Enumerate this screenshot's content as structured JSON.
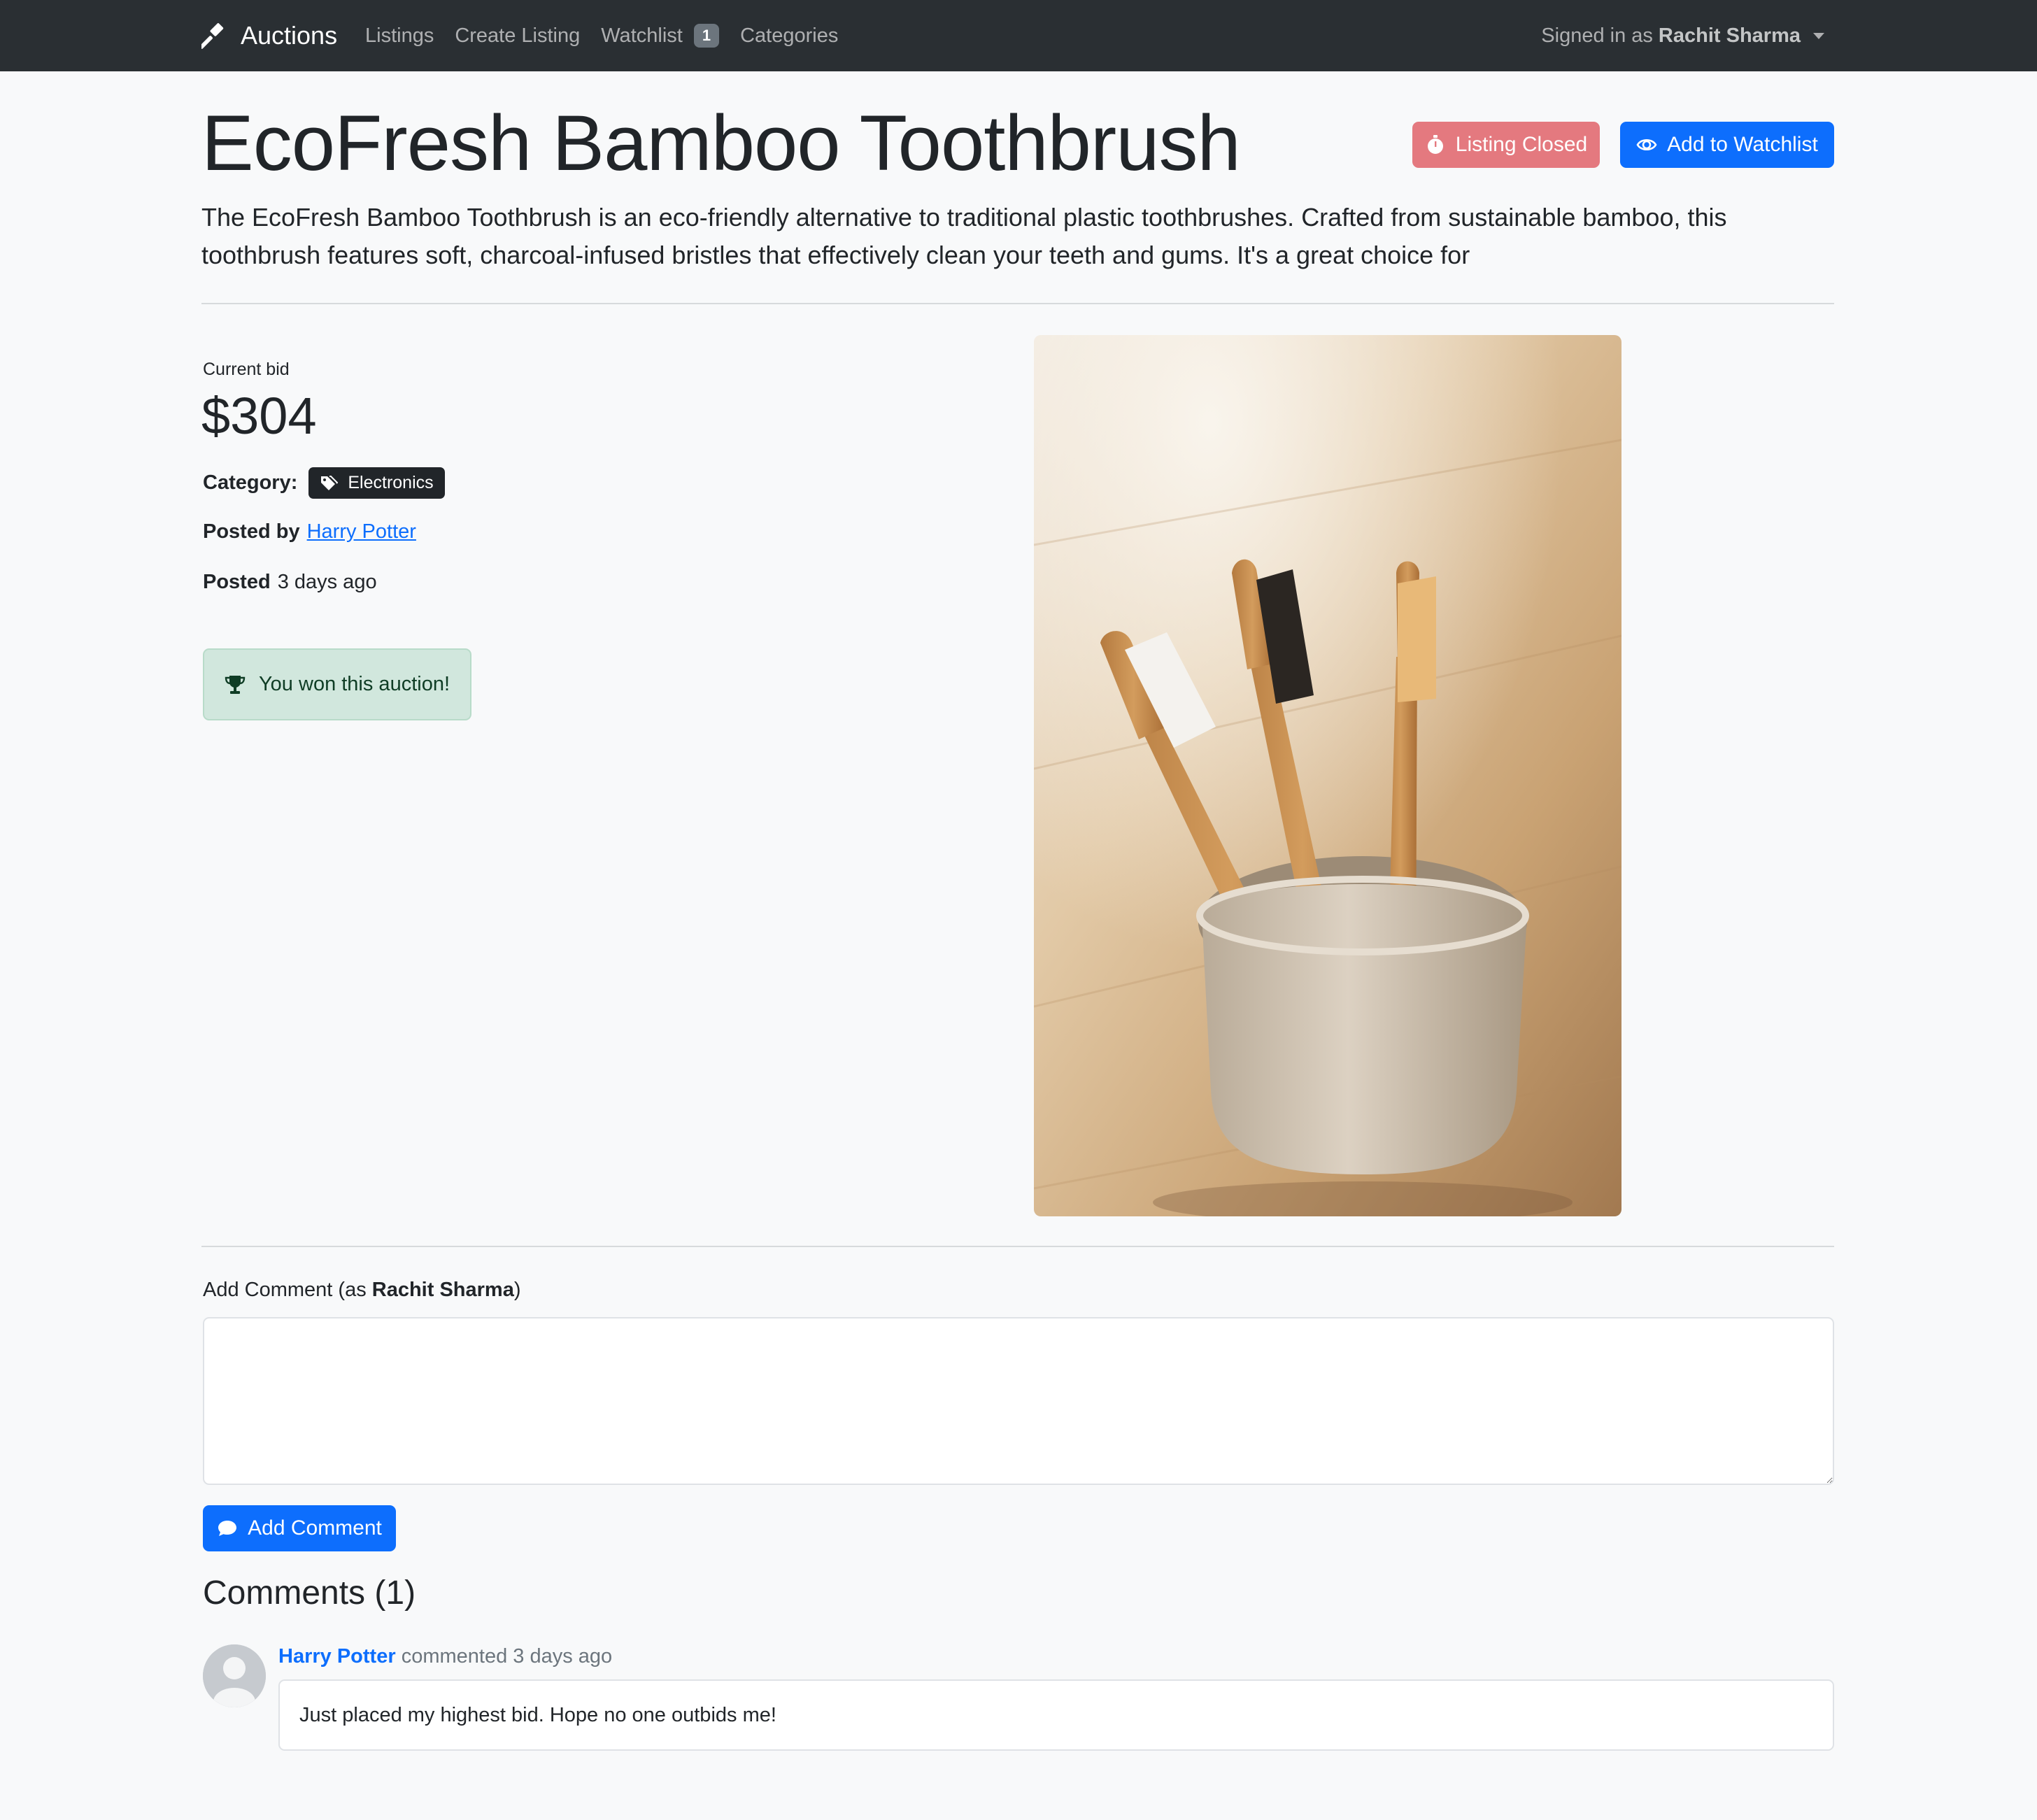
{
  "navbar": {
    "brand": "Auctions",
    "links": [
      "Listings",
      "Create Listing",
      "Watchlist",
      "Categories"
    ],
    "watchlist_count": "1",
    "signed_in_prefix": "Signed in as",
    "user_name": "Rachit Sharma"
  },
  "listing": {
    "title": "EcoFresh Bamboo Toothbrush",
    "description": "The EcoFresh Bamboo Toothbrush is an eco-friendly alternative to traditional plastic toothbrushes. Crafted from sustainable bamboo, this toothbrush features soft, charcoal-infused bristles that effectively clean your teeth and gums. It's a great choice for",
    "status_button": "Listing Closed",
    "watchlist_button": "Add to Watchlist",
    "current_bid_label": "Current bid",
    "current_bid": "$304",
    "category_label": "Category:",
    "category": "Electronics",
    "posted_by_label": "Posted by",
    "posted_by": "Harry Potter",
    "posted_label": "Posted",
    "posted_time": "3 days ago",
    "win_message": "You won this auction!"
  },
  "comment_form": {
    "label_prefix": "Add Comment (as",
    "user": "Rachit Sharma",
    "label_suffix": ")",
    "textarea_value": "",
    "submit_label": "Add Comment"
  },
  "comments": {
    "title": "Comments (1)",
    "items": [
      {
        "author": "Harry Potter",
        "action": "commented",
        "time": "3 days ago",
        "text": "Just placed my highest bid. Hope no one outbids me!"
      }
    ]
  },
  "colors": {
    "navbar": "#2a2f33",
    "primary": "#0d6efd",
    "danger_muted": "#e4797f",
    "success_bg": "#d1e7dd"
  },
  "icons": [
    "gavel-icon",
    "stopwatch-icon",
    "eye-icon",
    "tags-icon",
    "trophy-icon",
    "comment-icon",
    "user-avatar-icon",
    "toothbrush-photo"
  ]
}
